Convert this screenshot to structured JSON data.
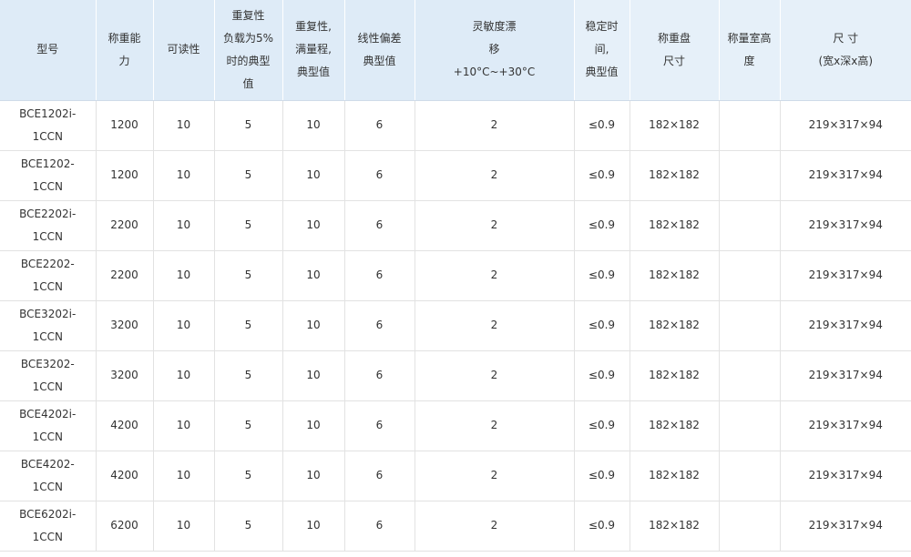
{
  "table": {
    "headers": [
      [
        "型号"
      ],
      [
        "称重能",
        "力"
      ],
      [
        "可读性"
      ],
      [
        "重复性",
        "负载为5%",
        "时的典型",
        "值"
      ],
      [
        "重复性,",
        "满量程,",
        "典型值"
      ],
      [
        "线性偏差",
        "典型值"
      ],
      [
        "灵敏度漂",
        "移",
        "+10°C~+30°C"
      ],
      [
        "稳定时",
        "间,",
        "典型值"
      ],
      [
        "称重盘",
        "尺寸"
      ],
      [
        "称量室高",
        "度"
      ],
      [
        "尺 寸",
        "(宽x深x高)"
      ]
    ],
    "rows": [
      {
        "model": [
          "BCE1202i-",
          "1CCN"
        ],
        "capacity": "1200",
        "readability": "10",
        "repeat5": "5",
        "repeatFull": "10",
        "linearity": "6",
        "drift": "2",
        "stab": "≤0.9",
        "pan": "182×182",
        "chamber": "",
        "dims": "219×317×94"
      },
      {
        "model": [
          "BCE1202-",
          "1CCN"
        ],
        "capacity": "1200",
        "readability": "10",
        "repeat5": "5",
        "repeatFull": "10",
        "linearity": "6",
        "drift": "2",
        "stab": "≤0.9",
        "pan": "182×182",
        "chamber": "",
        "dims": "219×317×94"
      },
      {
        "model": [
          "BCE2202i-",
          "1CCN"
        ],
        "capacity": "2200",
        "readability": "10",
        "repeat5": "5",
        "repeatFull": "10",
        "linearity": "6",
        "drift": "2",
        "stab": "≤0.9",
        "pan": "182×182",
        "chamber": "",
        "dims": "219×317×94"
      },
      {
        "model": [
          "BCE2202-",
          "1CCN"
        ],
        "capacity": "2200",
        "readability": "10",
        "repeat5": "5",
        "repeatFull": "10",
        "linearity": "6",
        "drift": "2",
        "stab": "≤0.9",
        "pan": "182×182",
        "chamber": "",
        "dims": "219×317×94"
      },
      {
        "model": [
          "BCE3202i-",
          "1CCN"
        ],
        "capacity": "3200",
        "readability": "10",
        "repeat5": "5",
        "repeatFull": "10",
        "linearity": "6",
        "drift": "2",
        "stab": "≤0.9",
        "pan": "182×182",
        "chamber": "",
        "dims": "219×317×94"
      },
      {
        "model": [
          "BCE3202-",
          "1CCN"
        ],
        "capacity": "3200",
        "readability": "10",
        "repeat5": "5",
        "repeatFull": "10",
        "linearity": "6",
        "drift": "2",
        "stab": "≤0.9",
        "pan": "182×182",
        "chamber": "",
        "dims": "219×317×94"
      },
      {
        "model": [
          "BCE4202i-",
          "1CCN"
        ],
        "capacity": "4200",
        "readability": "10",
        "repeat5": "5",
        "repeatFull": "10",
        "linearity": "6",
        "drift": "2",
        "stab": "≤0.9",
        "pan": "182×182",
        "chamber": "",
        "dims": "219×317×94"
      },
      {
        "model": [
          "BCE4202-",
          "1CCN"
        ],
        "capacity": "4200",
        "readability": "10",
        "repeat5": "5",
        "repeatFull": "10",
        "linearity": "6",
        "drift": "2",
        "stab": "≤0.9",
        "pan": "182×182",
        "chamber": "",
        "dims": "219×317×94"
      },
      {
        "model": [
          "BCE6202i-",
          "1CCN"
        ],
        "capacity": "6200",
        "readability": "10",
        "repeat5": "5",
        "repeatFull": "10",
        "linearity": "6",
        "drift": "2",
        "stab": "≤0.9",
        "pan": "182×182",
        "chamber": "",
        "dims": "219×317×94"
      }
    ]
  },
  "colors": {
    "header_bg": "#deebf7",
    "header_bg_alt": "#e6f0f9",
    "grid": "#e2e2e2",
    "text": "#333333"
  }
}
